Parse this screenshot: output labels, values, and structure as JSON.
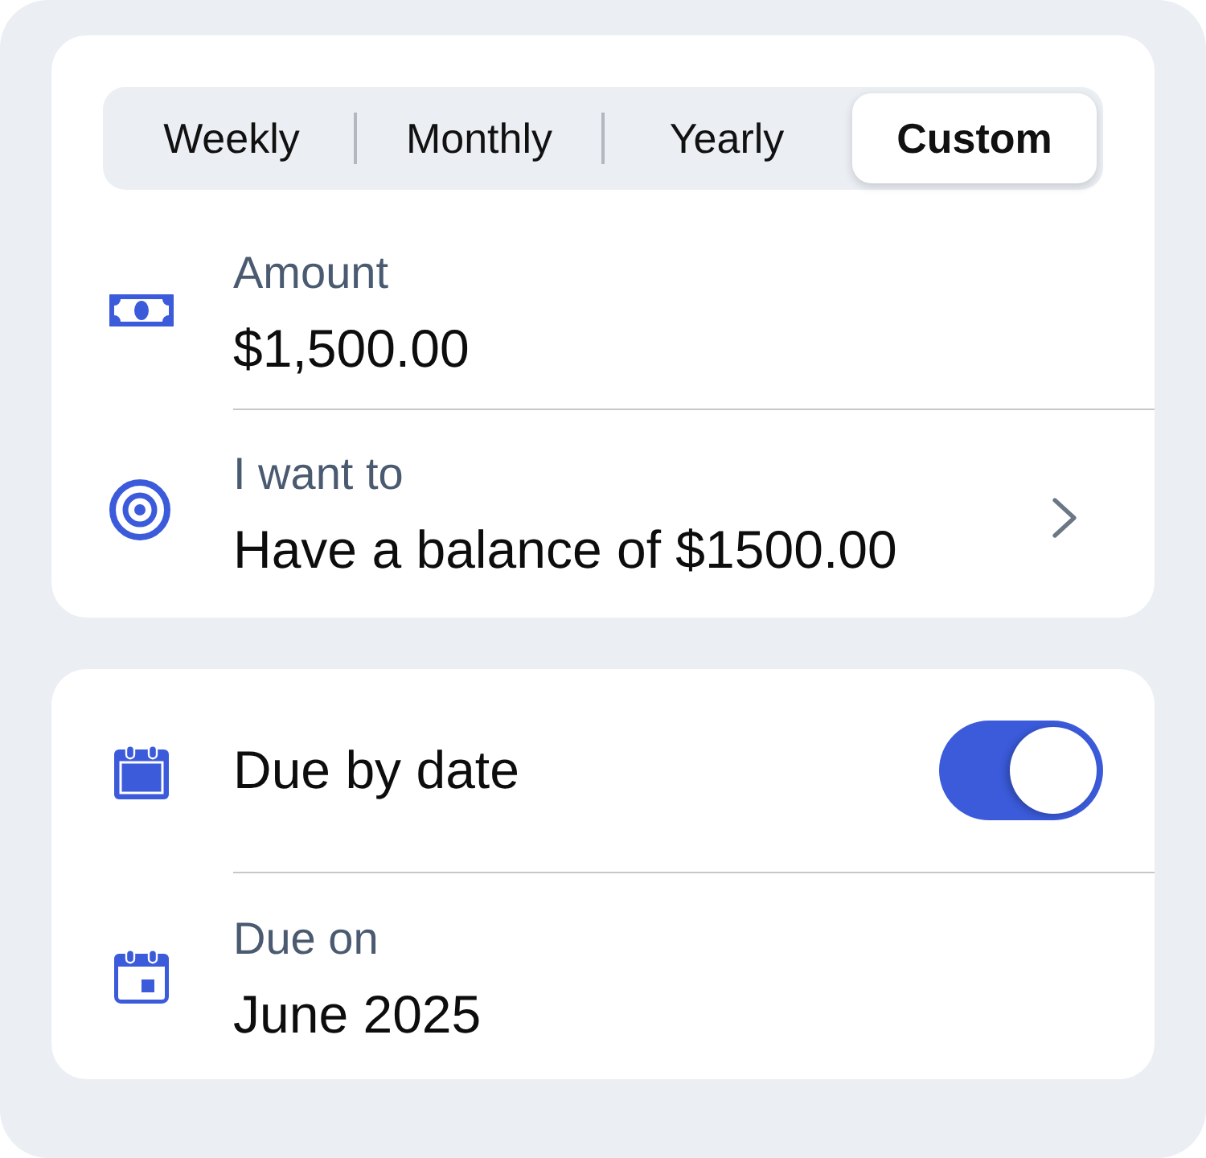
{
  "cards": [
    {
      "segments": [
        {
          "label": "Weekly",
          "selected": false
        },
        {
          "label": "Monthly",
          "selected": false
        },
        {
          "label": "Yearly",
          "selected": false
        },
        {
          "label": "Custom",
          "selected": true
        }
      ],
      "rows": [
        {
          "kind": "amount",
          "label": "Amount",
          "value": "$1,500.00",
          "chevron": false
        },
        {
          "kind": "target",
          "label": "I want to",
          "value": "Have a balance of $1500.00",
          "chevron": true
        }
      ]
    },
    {
      "rows": [
        {
          "kind": "toggle",
          "label": "Due by date",
          "on": true
        },
        {
          "kind": "date",
          "label": "Due on",
          "value": "June 2025"
        }
      ]
    }
  ]
}
